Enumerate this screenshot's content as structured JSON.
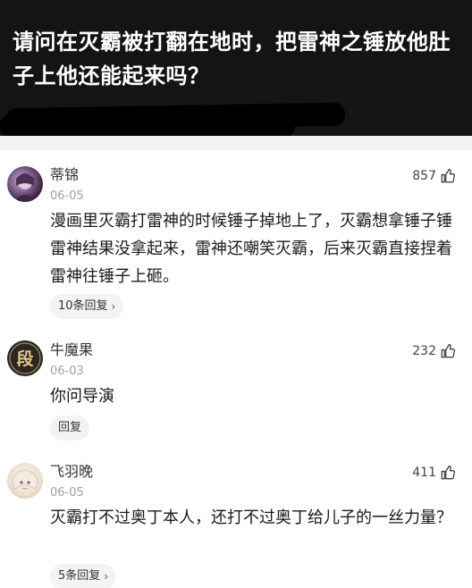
{
  "question": {
    "title": "请问在灭霸被打翻在地时，把雷神之锤放他肚子上他还能起来吗？"
  },
  "comments": [
    {
      "username": "蒂锦",
      "date": "06-05",
      "likes": "857",
      "content": "漫画里灭霸打雷神的时候锤子掉地上了，灭霸想拿锤子锤雷神结果没拿起来，雷神还嘲笑灭霸，后来灭霸直接捏着雷神往锤子上砸。",
      "reply_label": "10条回复",
      "avatar_icon": "avatar-anime-dark"
    },
    {
      "username": "牛魔果",
      "date": "06-03",
      "likes": "232",
      "content": "你问导演",
      "reply_label": "回复",
      "avatar_icon": "avatar-duan-emblem",
      "avatar_char": "段"
    },
    {
      "username": "飞羽晚",
      "date": "06-05",
      "likes": "411",
      "content": "灭霸打不过奥丁本人，还打不过奥丁给儿子的一丝力量？",
      "reply_label": "5条回复",
      "avatar_icon": "avatar-anime-light"
    }
  ],
  "icons": {
    "like": "thumbs-up-icon",
    "reply_chevron": "chevron-right-icon"
  },
  "colors": {
    "header_bg": "#141414",
    "date_gray": "#a0a0a0",
    "reply_bg": "#f3f3f3"
  }
}
